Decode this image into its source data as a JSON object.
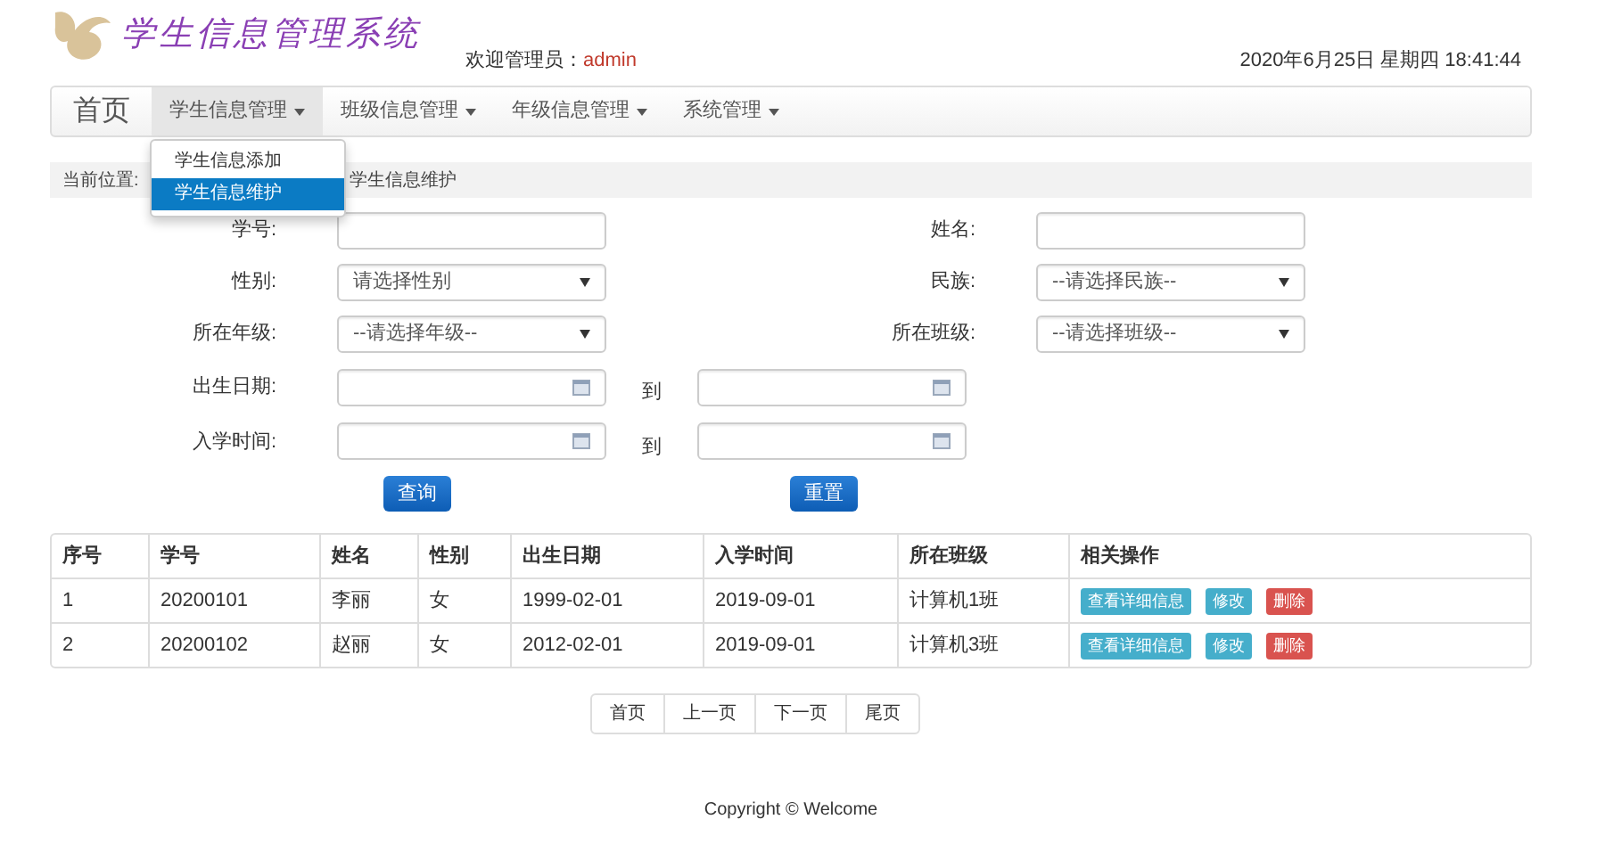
{
  "header": {
    "title": "学生信息管理系统",
    "welcome_label": "欢迎管理员：",
    "user": "admin",
    "datetime": "2020年6月25日 星期四 18:41:44"
  },
  "nav": {
    "brand": "首页",
    "items": [
      {
        "label": "学生信息管理",
        "selected": true
      },
      {
        "label": "班级信息管理",
        "selected": false
      },
      {
        "label": "年级信息管理",
        "selected": false
      },
      {
        "label": "系统管理",
        "selected": false
      }
    ],
    "dropdown": [
      {
        "label": "学生信息添加",
        "selected": false
      },
      {
        "label": "学生信息维护",
        "selected": true
      }
    ]
  },
  "breadcrumb": {
    "label": "当前位置:",
    "current": "学生信息维护"
  },
  "form": {
    "rows": [
      {
        "fields": [
          {
            "label": "学号:",
            "kind": "text"
          },
          {
            "label": "姓名:",
            "kind": "text"
          }
        ]
      },
      {
        "fields": [
          {
            "label": "性别:",
            "kind": "select",
            "value": "请选择性别"
          },
          {
            "label": "民族:",
            "kind": "select",
            "value": "--请选择民族--"
          }
        ]
      },
      {
        "fields": [
          {
            "label": "所在年级:",
            "kind": "select",
            "value": "--请选择年级--"
          },
          {
            "label": "所在班级:",
            "kind": "select",
            "value": "--请选择班级--"
          }
        ]
      },
      {
        "kind": "range",
        "label": "出生日期:",
        "to": "到"
      },
      {
        "kind": "range",
        "label": "入学时间:",
        "to": "到"
      }
    ],
    "buttons": [
      "查询",
      "重置"
    ]
  },
  "table": {
    "columns": [
      "序号",
      "学号",
      "姓名",
      "性别",
      "出生日期",
      "入学时间",
      "所在班级",
      "相关操作"
    ],
    "rows": [
      {
        "cells": [
          "1",
          "20200101",
          "李丽",
          "女",
          "1999-02-01",
          "2019-09-01",
          "计算机1班"
        ],
        "actions": [
          {
            "label": "查看详细信息",
            "kind": "info"
          },
          {
            "label": "修改",
            "kind": "info"
          },
          {
            "label": "删除",
            "kind": "danger"
          }
        ]
      },
      {
        "cells": [
          "2",
          "20200102",
          "赵丽",
          "女",
          "2012-02-01",
          "2019-09-01",
          "计算机3班"
        ],
        "actions": [
          {
            "label": "查看详细信息",
            "kind": "info"
          },
          {
            "label": "修改",
            "kind": "info"
          },
          {
            "label": "删除",
            "kind": "danger"
          }
        ]
      }
    ]
  },
  "pagination": [
    "首页",
    "上一页",
    "下一页",
    "尾页"
  ],
  "footer": "Copyright © Welcome"
}
